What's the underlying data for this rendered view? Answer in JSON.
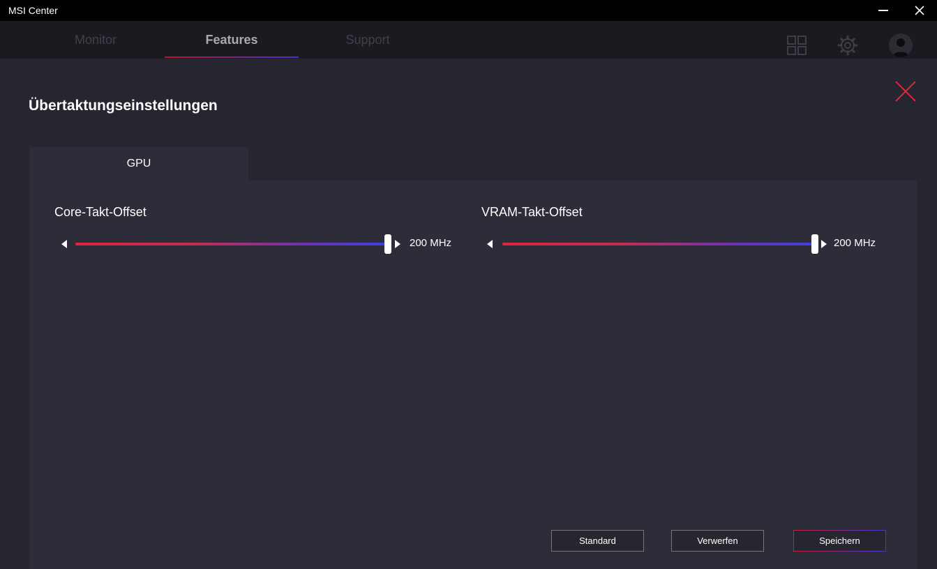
{
  "window": {
    "title": "MSI Center"
  },
  "nav": {
    "tabs": [
      {
        "label": "Monitor",
        "active": false
      },
      {
        "label": "Features",
        "active": true
      },
      {
        "label": "Support",
        "active": false
      }
    ],
    "icons": [
      "grid-icon",
      "gear-icon",
      "user-avatar-icon"
    ]
  },
  "panel": {
    "title": "Übertaktungseinstellungen",
    "tab": "GPU",
    "sliders": [
      {
        "label": "Core-Takt-Offset",
        "value_text": "200 MHz",
        "level": 1.0
      },
      {
        "label": "VRAM-Takt-Offset",
        "value_text": "200 MHz",
        "level": 1.0
      }
    ]
  },
  "buttons": {
    "standard": "Standard",
    "discard": "Verwerfen",
    "save": "Speichern"
  },
  "colors": {
    "accent_red": "#e0263f",
    "accent_blue": "#3d3fe0",
    "background": "#25262f",
    "panel": "#2c2d38"
  }
}
